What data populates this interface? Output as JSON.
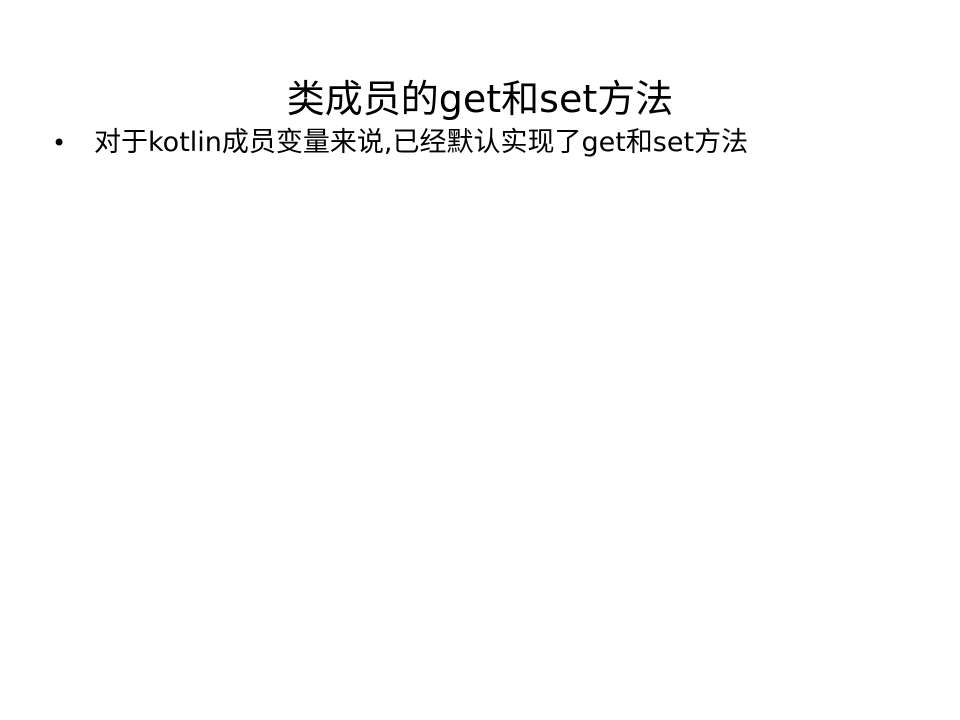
{
  "slide": {
    "title": "类成员的get和set方法",
    "bullets": [
      {
        "marker": "•",
        "text": "对于kotlin成员变量来说,已经默认实现了get和set方法"
      }
    ]
  }
}
